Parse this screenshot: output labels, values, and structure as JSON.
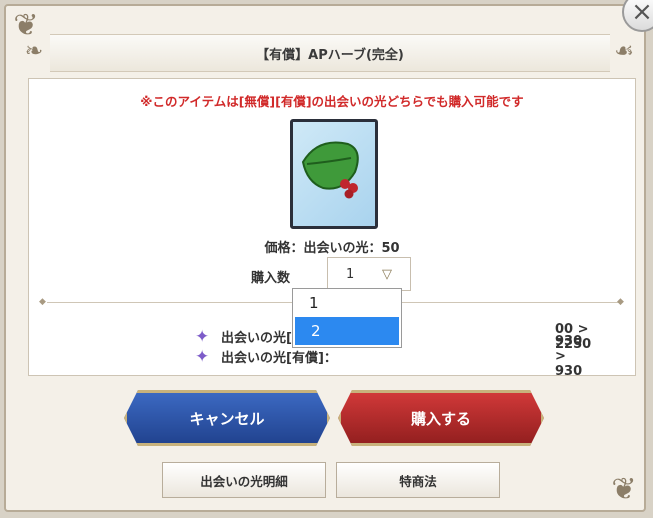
{
  "dialog": {
    "title": "【有償】APハーブ(完全)",
    "notice": "※このアイテムは[無償][有償]の出会いの光どちらでも購入可能です",
    "price": "価格：出会いの光：50",
    "quantity": {
      "label": "購入数",
      "value": "1",
      "arrow": "▽"
    },
    "balance_rows": [
      {
        "label": "出会いの光[",
        "value": "00 > 2250"
      },
      {
        "label": "出会いの光[有償]：",
        "value": "930 > 930"
      }
    ],
    "dropdown_options": [
      {
        "label": "1",
        "selected": false
      },
      {
        "label": "2",
        "selected": true
      }
    ],
    "buttons": {
      "cancel": "キャンセル",
      "buy": "購入する",
      "detail": "出会いの光明細",
      "law": "特商法"
    },
    "close_glyph": "×"
  },
  "colors": {
    "notice": "#d12a2a",
    "cancel": "#2a4f9c",
    "buy": "#b82b2b",
    "dropdown_selected": "#2c89f0"
  }
}
